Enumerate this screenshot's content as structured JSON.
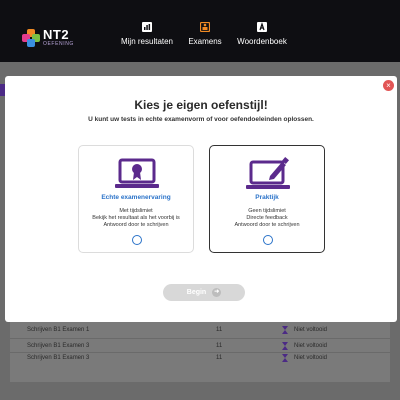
{
  "app": {
    "logo_text": "NT2",
    "logo_sub": "OEFENING"
  },
  "nav": {
    "items": [
      {
        "label": "Mijn resultaten",
        "icon": "bar-chart-icon"
      },
      {
        "label": "Examens",
        "icon": "exam-icon"
      },
      {
        "label": "Woordenboek",
        "icon": "dictionary-icon"
      }
    ]
  },
  "background_table": {
    "rows": [
      {
        "name": "Schrijven B1 Examen 1",
        "count": "11",
        "status": "Niet voltooid"
      },
      {
        "name": "Schrijven B1 Examen 3",
        "count": "11",
        "status": "Niet voltooid"
      },
      {
        "name": "Schrijven B1 Examen 3",
        "count": "11",
        "status": "Niet voltooid"
      }
    ]
  },
  "modal": {
    "title": "Kies je eigen oefenstijl!",
    "subtitle": "U kunt uw tests in echte examenvorm of voor oefendoeleinden oplossen.",
    "close_label": "×",
    "cards": [
      {
        "title": "Echte examenervaring",
        "lines": [
          "Met tijdslimiet",
          "Bekijk het resultaat als het voorbij is",
          "Antwoord door te schrijven"
        ],
        "icon": "laptop-certificate-icon"
      },
      {
        "title": "Praktijk",
        "lines": [
          "Geen tijdslimiet",
          "Directe feedback",
          "Antwoord door te schrijven"
        ],
        "icon": "laptop-pen-icon"
      }
    ],
    "begin_label": "Begin",
    "begin_icon": "arrow-right-icon"
  },
  "colors": {
    "accent_purple": "#5b2a8c",
    "accent_blue": "#2b73c9",
    "nav_orange": "#f08a24",
    "close_red": "#e25555"
  }
}
